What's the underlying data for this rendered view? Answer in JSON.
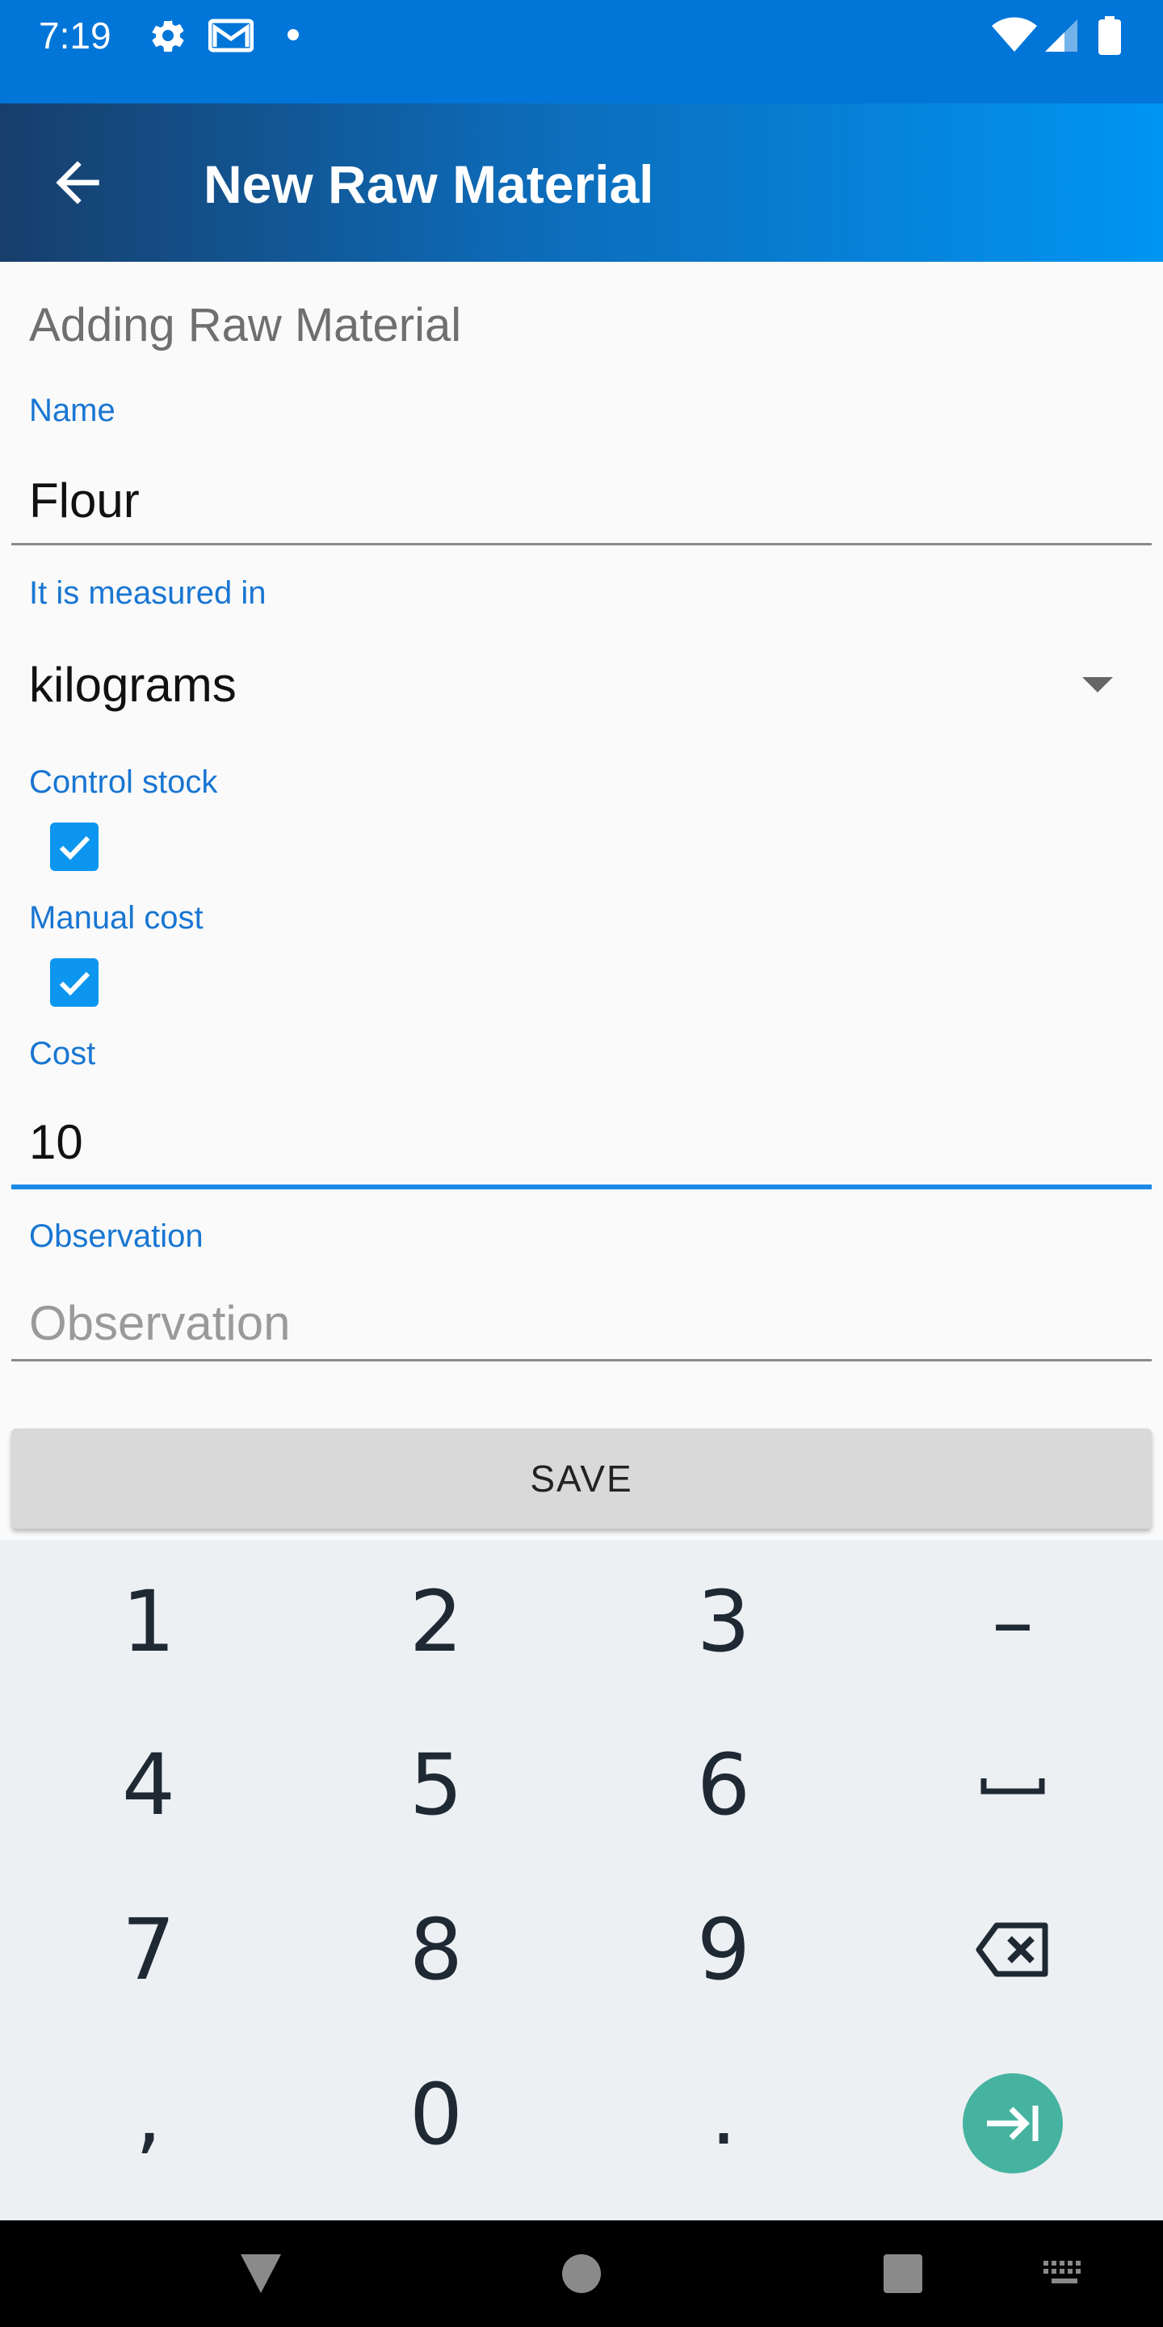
{
  "status_bar": {
    "time": "7:19",
    "icons": [
      "gear-icon",
      "gmail-icon",
      "dot-icon"
    ],
    "right_icons": [
      "wifi-icon",
      "signal-icon",
      "battery-icon"
    ]
  },
  "app_bar": {
    "title": "New Raw Material",
    "back_icon": "arrow-left-icon"
  },
  "form": {
    "section_title": "Adding Raw Material",
    "name": {
      "label": "Name",
      "value": "Flour"
    },
    "unit": {
      "label": "It is measured in",
      "value": "kilograms"
    },
    "control_stock": {
      "label": "Control stock",
      "checked": true
    },
    "manual_cost": {
      "label": "Manual cost",
      "checked": true
    },
    "cost": {
      "label": "Cost",
      "value": "10"
    },
    "observation": {
      "label": "Observation",
      "placeholder": "Observation",
      "value": ""
    },
    "save_label": "SAVE"
  },
  "keyboard": {
    "keys": [
      [
        "1",
        "2",
        "3",
        "–"
      ],
      [
        "4",
        "5",
        "6",
        "space"
      ],
      [
        "7",
        "8",
        "9",
        "backspace"
      ],
      [
        ",",
        "0",
        ".",
        "next"
      ]
    ]
  },
  "nav_bar": {
    "icons": [
      "back-triangle-icon",
      "home-circle-icon",
      "recents-square-icon",
      "keyboard-switch-icon"
    ]
  },
  "colors": {
    "status_bar": "#0175d8",
    "accent": "#1976d2",
    "checkbox": "#0d96ef",
    "enter_key": "#45b3a0"
  }
}
